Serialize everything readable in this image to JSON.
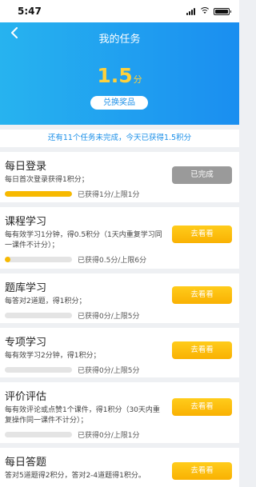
{
  "status_bar": {
    "time": "5:47"
  },
  "header": {
    "title": "我的任务",
    "score_value": "1.5",
    "score_unit": "分",
    "redeem_label": "兑换奖品"
  },
  "summary": {
    "text": "还有11个任务未完成，今天已获得1.5积分"
  },
  "colors": {
    "brand_blue": "#1a8ef0",
    "button_yellow": "#f9b102",
    "score_yellow": "#ffd13b",
    "done_gray": "#9a9a9a"
  },
  "tasks": [
    {
      "title": "每日登录",
      "desc": "每日首次登录获得1积分；",
      "progress_text": "已获得1分/上限1分",
      "progress": 1.0,
      "button_label": "已完成",
      "done": true
    },
    {
      "title": "课程学习",
      "desc": "每有效学习1分钟，得0.5积分（1天内重复学习同一课件不计分）；",
      "progress_text": "已获得0.5分/上限6分",
      "progress": 0.083,
      "button_label": "去看看",
      "done": false
    },
    {
      "title": "题库学习",
      "desc": "每答对2道题，得1积分；",
      "progress_text": "已获得0分/上限5分",
      "progress": 0,
      "button_label": "去看看",
      "done": false
    },
    {
      "title": "专项学习",
      "desc": "每有效学习2分钟，得1积分；",
      "progress_text": "已获得0分/上限5分",
      "progress": 0,
      "button_label": "去看看",
      "done": false
    },
    {
      "title": "评价评估",
      "desc": "每有效评论或点赞1个课件，得1积分（30天内重复操作同一课件不计分）；",
      "progress_text": "已获得0分/上限1分",
      "progress": 0,
      "button_label": "去看看",
      "done": false
    },
    {
      "title": "每日答题",
      "desc": "答对5道题得2积分，答对2-4道题得1积分。",
      "progress_text": "",
      "progress": 0,
      "button_label": "去看看",
      "done": false
    }
  ]
}
